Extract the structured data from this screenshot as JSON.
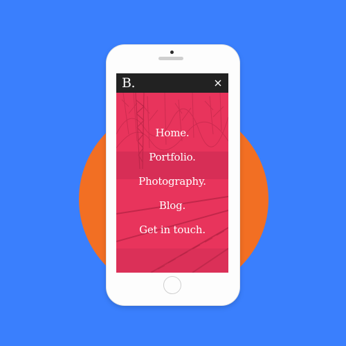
{
  "colors": {
    "background": "#3a7ffd",
    "circle": "#f26f23",
    "overlay": "#e8345c",
    "topbar": "#222222"
  },
  "header": {
    "logo": "B.",
    "close_icon": "close-icon"
  },
  "menu": {
    "items": [
      {
        "label": "Home."
      },
      {
        "label": "Portfolio."
      },
      {
        "label": "Photography."
      },
      {
        "label": "Blog."
      },
      {
        "label": "Get in touch."
      }
    ]
  }
}
